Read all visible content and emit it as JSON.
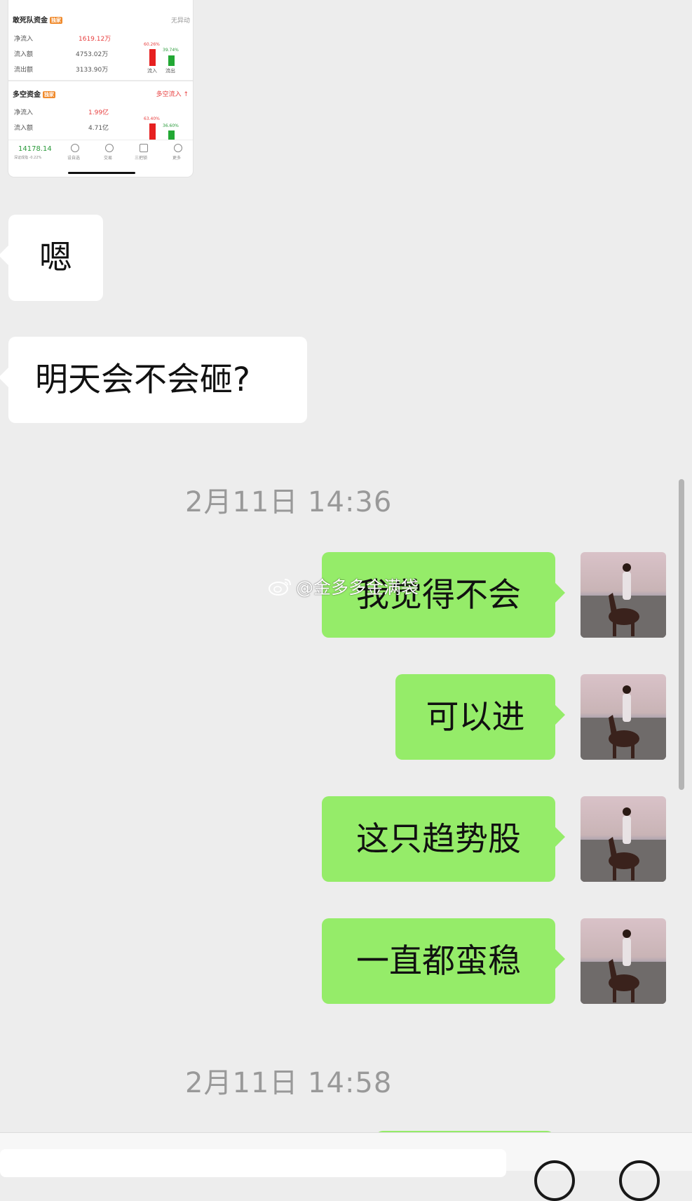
{
  "thumbnail": {
    "section1_title": "敢死队资金",
    "section1_tag": "独家",
    "section1_status": "无异动",
    "rows1": [
      {
        "label": "净流入",
        "value": "1619.12万"
      },
      {
        "label": "流入额",
        "value": "4753.02万"
      },
      {
        "label": "流出额",
        "value": "3133.90万"
      }
    ],
    "pct_in_1": "60.26%",
    "pct_out_1": "39.74%",
    "bar_label_in": "流入",
    "bar_label_out": "流出",
    "section2_title": "多空资金",
    "section2_tag": "独家",
    "section2_status": "多空流入",
    "rows2": [
      {
        "label": "净流入",
        "value": "1.99亿"
      },
      {
        "label": "流入额",
        "value": "4.71亿"
      }
    ],
    "pct_in_2": "63.40%",
    "pct_out_2": "36.60%",
    "index_value": "14178.14",
    "index_sub": "深证成指 -0.22%",
    "nav": [
      "设自选",
      "交易",
      "三把锁",
      "更多"
    ]
  },
  "messages": [
    {
      "side": "left",
      "text": "嗯"
    },
    {
      "side": "left",
      "text": "明天会不会砸?"
    },
    {
      "side": "time",
      "text": "2月11日 14:36"
    },
    {
      "side": "right",
      "text": "我觉得不会"
    },
    {
      "side": "right",
      "text": "可以进"
    },
    {
      "side": "right",
      "text": "这只趋势股"
    },
    {
      "side": "right",
      "text": "一直都蛮稳"
    },
    {
      "side": "time",
      "text": "2月11日 14:58"
    }
  ],
  "watermark": "@金多多金满袋",
  "colors": {
    "background": "#ededed",
    "bubble_left": "#ffffff",
    "bubble_right": "#95ec69",
    "timestamp": "#999999",
    "rise": "#e84040",
    "fall": "#2a9a3a"
  }
}
